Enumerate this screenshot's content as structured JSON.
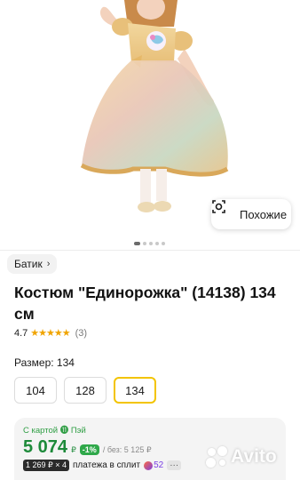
{
  "gallery": {
    "similar_label": "Похожие",
    "dots_count": 5,
    "active_dot": 0
  },
  "brand": {
    "label": "Батик",
    "chevron": "›"
  },
  "product": {
    "title": "Костюм \"Единорожка\" (14138) 134 см",
    "rating": "4.7",
    "stars": "★★★★★",
    "reviews": "(3)"
  },
  "size": {
    "label": "Размер: 134",
    "options": [
      "104",
      "128",
      "134"
    ],
    "selected": "134"
  },
  "pricing": {
    "card_label": "С картой ⓫ Пэй",
    "price": "5 074",
    "currency": "₽",
    "discount": "-1%",
    "without": "/ без: 5 125 ₽",
    "split_chip": "1 269 ₽ × 4",
    "split_text": "платежа в сплит",
    "plus_points": "52",
    "more": "···"
  },
  "watermark": {
    "text": "Avito"
  },
  "colors": {
    "accent_yellow": "#f3c400",
    "price_green": "#1d8a3a",
    "discount_green": "#2fa84a",
    "star": "#f0a400"
  }
}
